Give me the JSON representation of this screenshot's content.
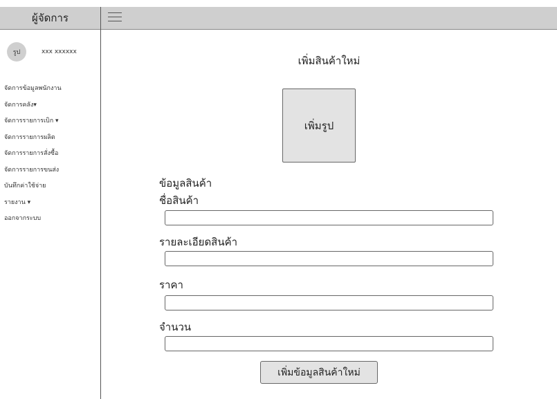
{
  "sidebar": {
    "title": "ผู้จัดการ",
    "avatar_text": "รูป",
    "username": "xxx xxxxxx",
    "items": [
      "จัดการข้อมูลพนักงาน",
      "จัดการคลัง▾",
      "จัดการรายการเบิก ▾",
      "จัดการรายการผลิต",
      "จัดการรายการสั่งซื้อ",
      "จัดการรายการขนส่ง",
      "บันทึกค่าใช้จ่าย",
      "รายงาน ▾",
      "ออกจากระบบ"
    ]
  },
  "topbar": {
    "menu_icon": "hamburger-menu-icon"
  },
  "form": {
    "title": "เพิ่มสินค้าใหม่",
    "image_button": "เพิ่มรูป",
    "section_label": "ข้อมูลสินค้า",
    "name_label": "ชื่อสินค้า",
    "name_value": "",
    "detail_label": "รายละเอียดสินค้า",
    "detail_value": "",
    "price_label": "ราคา",
    "price_value": "",
    "qty_label": "จำนวน",
    "qty_value": "",
    "submit_label": "เพิ่มข้อมูลสินค้าใหม่"
  },
  "colors": {
    "header_bg": "#cfcfcf",
    "button_bg": "#e3e3e3",
    "border": "#666666"
  }
}
